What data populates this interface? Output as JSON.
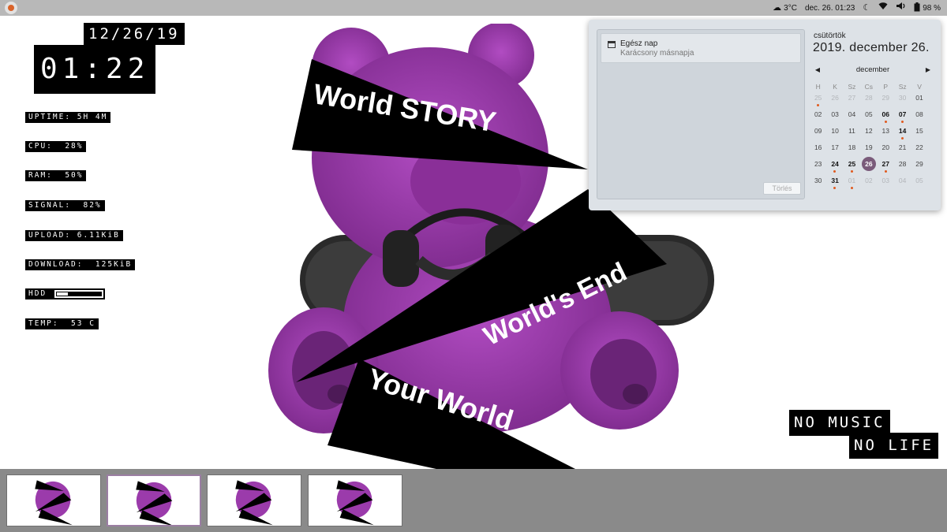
{
  "topbar": {
    "weather": "3°C",
    "datetime": "dec. 26.  01:23",
    "battery": "98 %",
    "icons": [
      "weather-icon",
      "night-light-icon",
      "wifi-icon",
      "volume-icon",
      "battery-icon"
    ]
  },
  "conky": {
    "date": "12/26/19",
    "time": "01:22",
    "uptime": "UPTIME: 5H 4M",
    "cpu": "CPU:  28%",
    "ram": "RAM:  50%",
    "signal": "SIGNAL:  82%",
    "upload": "UPLOAD: 6.11KiB",
    "download": "DOWNLOAD:  125KiB",
    "hdd_label": "HDD",
    "hdd_fraction": 0.25,
    "temp": "TEMP:  53 C"
  },
  "wallpaper": {
    "banner1": "World STORY",
    "banner2": "World's End",
    "banner3": "Your World",
    "quote_line1": "NO MUSIC",
    "quote_line2": "NO LIFE",
    "accent": "#a43fb3"
  },
  "calendar": {
    "event_title": "Egész nap",
    "event_subtitle": "Karácsony másnapja",
    "clear_button": "Törlés",
    "weekday": "csütörtök",
    "full_date": "2019. december 26.",
    "month": "december",
    "day_headers": [
      "H",
      "K",
      "Sz",
      "Cs",
      "P",
      "Sz",
      "V"
    ],
    "weeks": [
      [
        "25",
        "26",
        "27",
        "28",
        "29",
        "30",
        "01"
      ],
      [
        "02",
        "03",
        "04",
        "05",
        "06",
        "07",
        "08"
      ],
      [
        "09",
        "10",
        "11",
        "12",
        "13",
        "14",
        "15"
      ],
      [
        "16",
        "17",
        "18",
        "19",
        "20",
        "21",
        "22"
      ],
      [
        "23",
        "24",
        "25",
        "26",
        "27",
        "28",
        "29"
      ],
      [
        "30",
        "31",
        "01",
        "02",
        "03",
        "04",
        "05"
      ]
    ],
    "today_accent": "#7a5b7a"
  },
  "dock": {
    "workspaces": 4,
    "active_index": 1
  }
}
